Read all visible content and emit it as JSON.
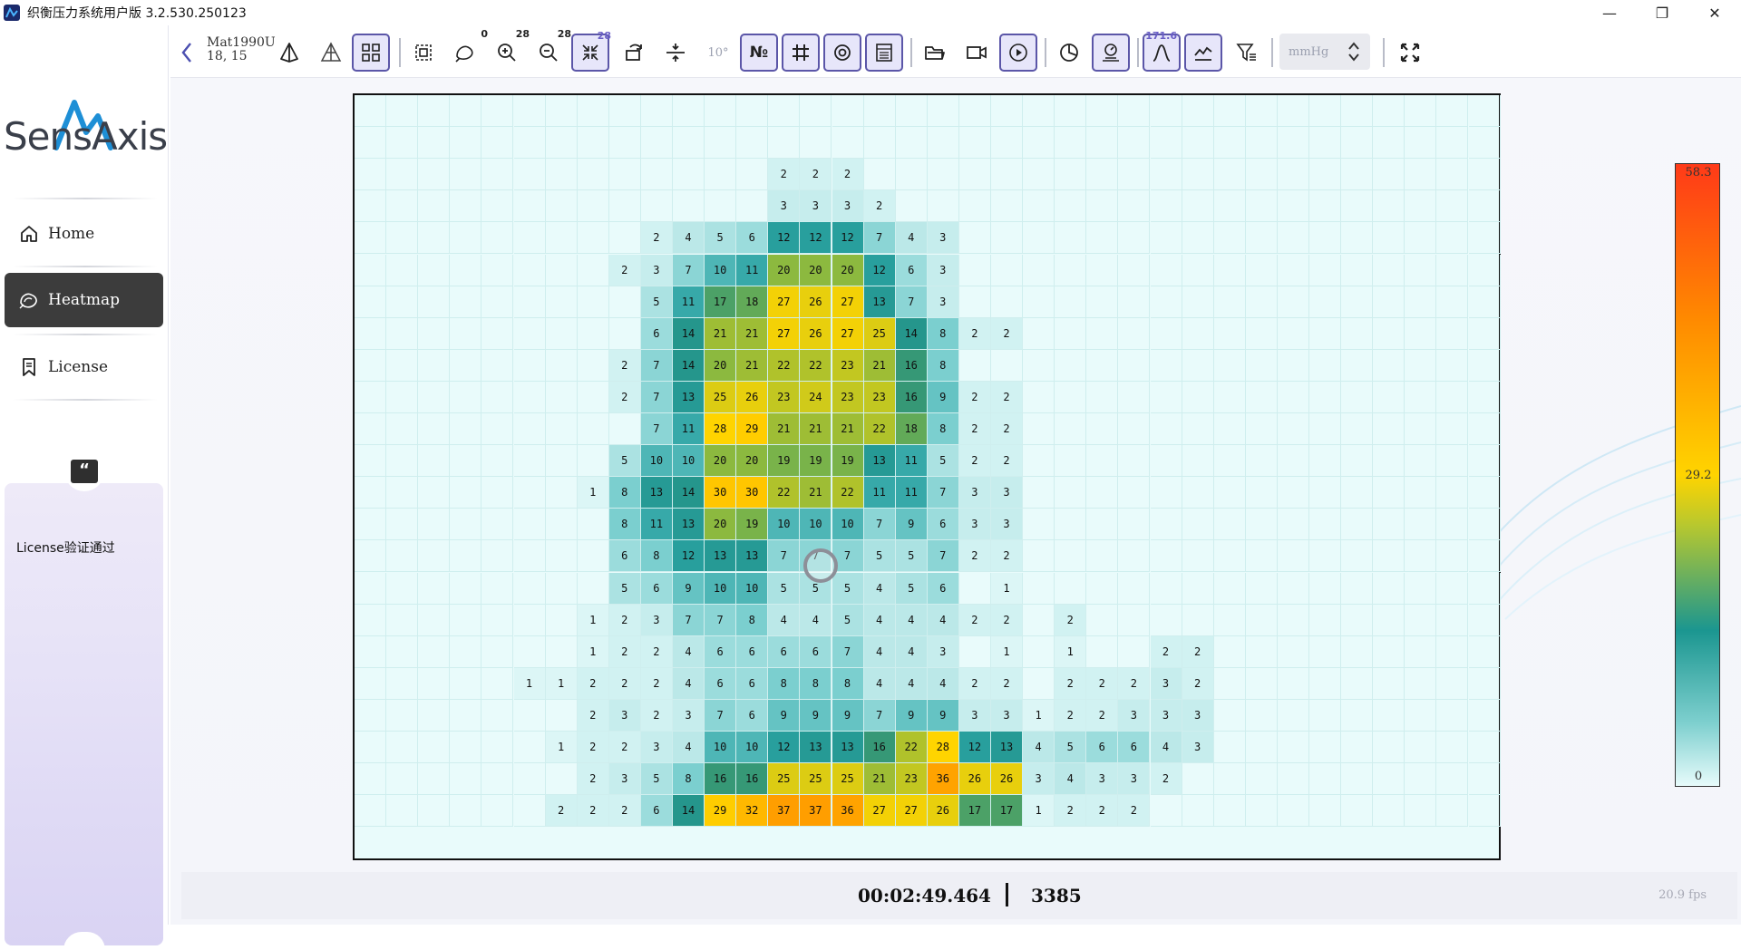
{
  "window": {
    "title": "织衡压力系统用户版 3.2.530.250123",
    "minimize": "—",
    "maximize": "❐",
    "close": "✕"
  },
  "sidebar": {
    "logo_text": "SensAxis",
    "items": [
      {
        "label": "Home",
        "icon": "home-icon"
      },
      {
        "label": "Heatmap",
        "icon": "heatmap-icon",
        "active": true
      },
      {
        "label": "License",
        "icon": "bookmark-icon"
      }
    ],
    "quote_symbol": "“",
    "license_message": "License验证通过"
  },
  "toolbar": {
    "mat_name": "Mat1990U",
    "mat_dims": "18, 15",
    "badge_rotate": "0",
    "badge_zoom_in": "28",
    "badge_zoom_out": "28",
    "badge_shrink": "28",
    "angle": "10°",
    "peak_badge": "171.6",
    "unit": "mmHg"
  },
  "heatmap": {
    "colorbar_max": "58.3",
    "colorbar_mid": "29.2",
    "colorbar_min": "0",
    "min_value": 0,
    "max_value": 58.3,
    "rows": [
      [
        0,
        0,
        0,
        0,
        0,
        0,
        0,
        0,
        0,
        0,
        0,
        0,
        0,
        0,
        0,
        0,
        0,
        0,
        0,
        0,
        0,
        0,
        0,
        0,
        0,
        0,
        0,
        0,
        0,
        0,
        0,
        0,
        0,
        0,
        0,
        0
      ],
      [
        0,
        0,
        0,
        0,
        0,
        0,
        0,
        0,
        0,
        0,
        0,
        0,
        0,
        0,
        0,
        0,
        0,
        0,
        0,
        0,
        0,
        0,
        0,
        0,
        0,
        0,
        0,
        0,
        0,
        0,
        0,
        0,
        0,
        0,
        0,
        0
      ],
      [
        0,
        0,
        0,
        0,
        0,
        0,
        0,
        0,
        0,
        0,
        0,
        0,
        0,
        2,
        2,
        2,
        0,
        0,
        0,
        0,
        0,
        0,
        0,
        0,
        0,
        0,
        0,
        0,
        0,
        0,
        0,
        0,
        0,
        0,
        0,
        0
      ],
      [
        0,
        0,
        0,
        0,
        0,
        0,
        0,
        0,
        0,
        0,
        0,
        0,
        0,
        3,
        3,
        3,
        2,
        0,
        0,
        0,
        0,
        0,
        0,
        0,
        0,
        0,
        0,
        0,
        0,
        0,
        0,
        0,
        0,
        0,
        0,
        0
      ],
      [
        0,
        0,
        0,
        0,
        0,
        0,
        0,
        0,
        0,
        2,
        4,
        5,
        6,
        12,
        12,
        12,
        7,
        4,
        3,
        0,
        0,
        0,
        0,
        0,
        0,
        0,
        0,
        0,
        0,
        0,
        0,
        0,
        0,
        0,
        0,
        0
      ],
      [
        0,
        0,
        0,
        0,
        0,
        0,
        0,
        0,
        2,
        3,
        7,
        10,
        11,
        20,
        20,
        20,
        12,
        6,
        3,
        0,
        0,
        0,
        0,
        0,
        0,
        0,
        0,
        0,
        0,
        0,
        0,
        0,
        0,
        0,
        0,
        0
      ],
      [
        0,
        0,
        0,
        0,
        0,
        0,
        0,
        0,
        0,
        5,
        11,
        17,
        18,
        27,
        26,
        27,
        13,
        7,
        3,
        0,
        0,
        0,
        0,
        0,
        0,
        0,
        0,
        0,
        0,
        0,
        0,
        0,
        0,
        0,
        0,
        0
      ],
      [
        0,
        0,
        0,
        0,
        0,
        0,
        0,
        0,
        0,
        6,
        14,
        21,
        21,
        27,
        26,
        27,
        25,
        14,
        8,
        2,
        2,
        0,
        0,
        0,
        0,
        0,
        0,
        0,
        0,
        0,
        0,
        0,
        0,
        0,
        0,
        0
      ],
      [
        0,
        0,
        0,
        0,
        0,
        0,
        0,
        0,
        2,
        7,
        14,
        20,
        21,
        22,
        22,
        23,
        21,
        16,
        8,
        0,
        0,
        0,
        0,
        0,
        0,
        0,
        0,
        0,
        0,
        0,
        0,
        0,
        0,
        0,
        0,
        0
      ],
      [
        0,
        0,
        0,
        0,
        0,
        0,
        0,
        0,
        2,
        7,
        13,
        25,
        26,
        23,
        24,
        23,
        23,
        16,
        9,
        2,
        2,
        0,
        0,
        0,
        0,
        0,
        0,
        0,
        0,
        0,
        0,
        0,
        0,
        0,
        0,
        0
      ],
      [
        0,
        0,
        0,
        0,
        0,
        0,
        0,
        0,
        0,
        7,
        11,
        28,
        29,
        21,
        21,
        21,
        22,
        18,
        8,
        2,
        2,
        0,
        0,
        0,
        0,
        0,
        0,
        0,
        0,
        0,
        0,
        0,
        0,
        0,
        0,
        0
      ],
      [
        0,
        0,
        0,
        0,
        0,
        0,
        0,
        0,
        5,
        10,
        10,
        20,
        20,
        19,
        19,
        19,
        13,
        11,
        5,
        2,
        2,
        0,
        0,
        0,
        0,
        0,
        0,
        0,
        0,
        0,
        0,
        0,
        0,
        0,
        0,
        0
      ],
      [
        0,
        0,
        0,
        0,
        0,
        0,
        0,
        1,
        8,
        13,
        14,
        30,
        30,
        22,
        21,
        22,
        11,
        11,
        7,
        3,
        3,
        0,
        0,
        0,
        0,
        0,
        0,
        0,
        0,
        0,
        0,
        0,
        0,
        0,
        0,
        0
      ],
      [
        0,
        0,
        0,
        0,
        0,
        0,
        0,
        0,
        8,
        11,
        13,
        20,
        19,
        10,
        10,
        10,
        7,
        9,
        6,
        3,
        3,
        0,
        0,
        0,
        0,
        0,
        0,
        0,
        0,
        0,
        0,
        0,
        0,
        0,
        0,
        0
      ],
      [
        0,
        0,
        0,
        0,
        0,
        0,
        0,
        0,
        6,
        8,
        12,
        13,
        13,
        7,
        7,
        7,
        5,
        5,
        7,
        2,
        2,
        0,
        0,
        0,
        0,
        0,
        0,
        0,
        0,
        0,
        0,
        0,
        0,
        0,
        0,
        0
      ],
      [
        0,
        0,
        0,
        0,
        0,
        0,
        0,
        0,
        5,
        6,
        9,
        10,
        10,
        5,
        5,
        5,
        4,
        5,
        6,
        0,
        1,
        0,
        0,
        0,
        0,
        0,
        0,
        0,
        0,
        0,
        0,
        0,
        0,
        0,
        0,
        0
      ],
      [
        0,
        0,
        0,
        0,
        0,
        0,
        0,
        1,
        2,
        3,
        7,
        7,
        8,
        4,
        4,
        5,
        4,
        4,
        4,
        2,
        2,
        0,
        2,
        0,
        0,
        0,
        0,
        0,
        0,
        0,
        0,
        0,
        0,
        0,
        0,
        0
      ],
      [
        0,
        0,
        0,
        0,
        0,
        0,
        0,
        1,
        2,
        2,
        4,
        6,
        6,
        6,
        6,
        7,
        4,
        4,
        3,
        0,
        1,
        0,
        1,
        0,
        0,
        2,
        2,
        0,
        0,
        0,
        0,
        0,
        0,
        0,
        0,
        0
      ],
      [
        0,
        0,
        0,
        0,
        0,
        1,
        1,
        2,
        2,
        2,
        4,
        6,
        6,
        8,
        8,
        8,
        4,
        4,
        4,
        2,
        2,
        0,
        2,
        2,
        2,
        3,
        2,
        0,
        0,
        0,
        0,
        0,
        0,
        0,
        0,
        0
      ],
      [
        0,
        0,
        0,
        0,
        0,
        0,
        0,
        2,
        3,
        2,
        3,
        7,
        6,
        9,
        9,
        9,
        7,
        9,
        9,
        3,
        3,
        1,
        2,
        2,
        3,
        3,
        3,
        0,
        0,
        0,
        0,
        0,
        0,
        0,
        0,
        0
      ],
      [
        0,
        0,
        0,
        0,
        0,
        0,
        1,
        2,
        2,
        3,
        4,
        10,
        10,
        12,
        13,
        13,
        16,
        22,
        28,
        12,
        13,
        4,
        5,
        6,
        6,
        4,
        3,
        0,
        0,
        0,
        0,
        0,
        0,
        0,
        0,
        0
      ],
      [
        0,
        0,
        0,
        0,
        0,
        0,
        0,
        2,
        3,
        5,
        8,
        16,
        16,
        25,
        25,
        25,
        21,
        23,
        36,
        26,
        26,
        3,
        4,
        3,
        3,
        2,
        0,
        0,
        0,
        0,
        0,
        0,
        0,
        0,
        0,
        0
      ],
      [
        0,
        0,
        0,
        0,
        0,
        0,
        2,
        2,
        2,
        6,
        14,
        29,
        32,
        37,
        37,
        36,
        27,
        27,
        26,
        17,
        17,
        1,
        2,
        2,
        2,
        0,
        0,
        0,
        0,
        0,
        0,
        0,
        0,
        0,
        0,
        0
      ]
    ]
  },
  "footer": {
    "time": "00:02:49.464",
    "frame": "3385",
    "fps": "20.9 fps"
  }
}
